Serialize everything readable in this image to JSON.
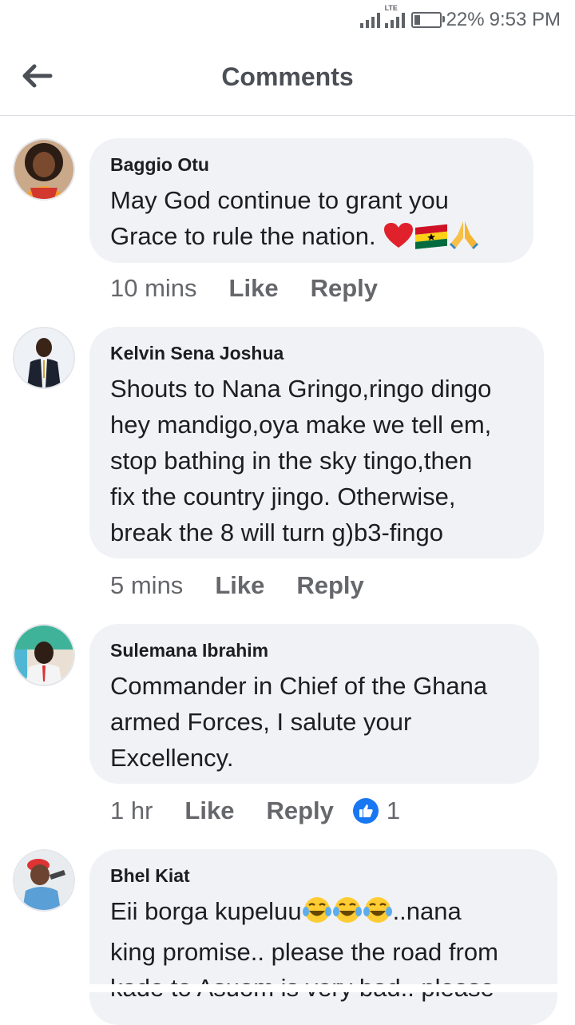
{
  "status": {
    "network": "LTE",
    "battery_percent": 22,
    "battery_label": "22%",
    "time": "9:53 PM"
  },
  "header": {
    "back_icon": "arrow-left-icon",
    "title": "Comments"
  },
  "comments": [
    {
      "author": "Baggio Otu",
      "text": "May God continue to grant you Grace to rule the nation.",
      "emojis": [
        "red-heart-icon",
        "ghana-flag-icon",
        "folded-hands-icon"
      ],
      "time": "10 mins",
      "like_label": "Like",
      "reply_label": "Reply"
    },
    {
      "author": "Kelvin Sena Joshua",
      "lines": [
        "Shouts to Nana Gringo,ringo dingo",
        "hey mandigo,oya make we tell em,",
        "stop bathing in the sky tingo,then",
        "fix the country jingo. Otherwise,",
        "break the 8 will turn g)b3-fingo"
      ],
      "time": "5 mins",
      "like_label": "Like",
      "reply_label": "Reply"
    },
    {
      "author": "Sulemana Ibrahim",
      "lines": [
        "Commander in Chief of the Ghana",
        "armed Forces, I salute your",
        "Excellency."
      ],
      "time": "1 hr",
      "like_label": "Like",
      "reply_label": "Reply",
      "reaction_icon": "thumbs-up-icon",
      "reaction_count": "1"
    },
    {
      "author": "Bhel Kiat",
      "line1_prefix": "Eii borga kupeluu",
      "line1_suffix": "..nana",
      "emojis": [
        "tears-of-joy-icon",
        "tears-of-joy-icon",
        "tears-of-joy-icon"
      ],
      "line2": "king promise.. please the road from",
      "line3": "kade to Asuom is very bad.. please"
    }
  ]
}
